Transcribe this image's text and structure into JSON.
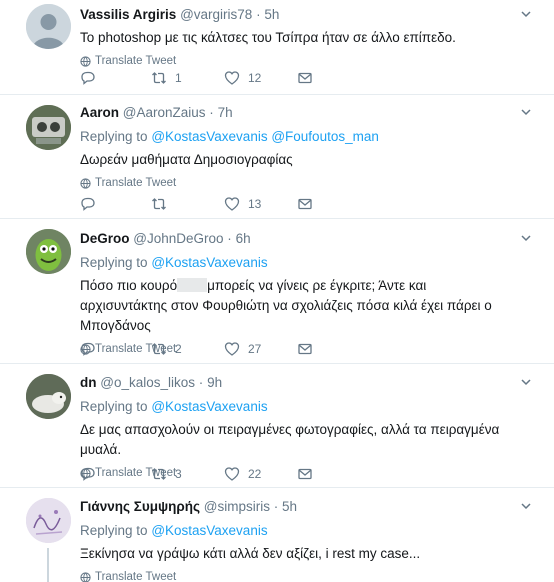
{
  "tweets": [
    {
      "name": "Vassilis Argiris",
      "handle": "@vargiris78",
      "time": "5h",
      "replying": "",
      "mentions": [],
      "text": "Το photoshop με τις κάλτσες του Τσίπρα ήταν σε άλλο επίπεδο.",
      "translate": "Translate Tweet",
      "replies": "",
      "retweets": "1",
      "likes": "12"
    },
    {
      "name": "Aaron",
      "handle": "@AaronZaius",
      "time": "7h",
      "replying": "Replying to",
      "mentions": [
        "@KostasVaxevanis",
        "@Foufoutos_man"
      ],
      "text": "Δωρεάν μαθήματα Δημοσιογραφίας",
      "translate": "Translate Tweet",
      "replies": "",
      "retweets": "",
      "likes": "13"
    },
    {
      "name": "DeGroo",
      "handle": "@JohnDeGroo",
      "time": "6h",
      "replying": "Replying to",
      "mentions": [
        "@KostasVaxevanis"
      ],
      "text_a": "Πόσο πιο κουρό",
      "text_b": "μπορείς να γίνεις ρε έγκριτε; Άντε και αρχισυντάκτης στον Φουρθιώτη να σχολιάζεις πόσα κιλά έχει πάρει ο Μπογδάνος",
      "translate": "Translate Tweet",
      "replies": "",
      "retweets": "2",
      "likes": "27"
    },
    {
      "name": "dn",
      "handle": "@o_kalos_likos",
      "time": "9h",
      "replying": "Replying to",
      "mentions": [
        "@KostasVaxevanis"
      ],
      "text": "Δε μας απασχολούν οι πειραγμένες φωτογραφίες, αλλά τα πειραγμένα μυαλά.",
      "translate": "Translate Tweet",
      "replies": "",
      "retweets": "3",
      "likes": "22"
    },
    {
      "name": "Γιάννης Συμψηρής",
      "handle": "@simpsiris",
      "time": "5h",
      "replying": "Replying to",
      "mentions": [
        "@KostasVaxevanis"
      ],
      "text": "Ξεκίνησα να γράψω κάτι αλλά δεν αξίζει, i rest my case...",
      "translate": "Translate Tweet"
    }
  ],
  "dot": "·",
  "colors": {
    "accent": "#1da1f2",
    "muted": "#657786"
  },
  "icons": [
    "reply-icon",
    "retweet-icon",
    "like-icon",
    "message-icon",
    "globe-icon",
    "chevron-down-icon"
  ]
}
